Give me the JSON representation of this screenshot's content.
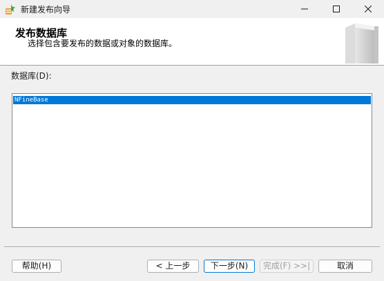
{
  "window": {
    "title": "新建发布向导",
    "controls": [
      "minimize-icon",
      "maximize-icon",
      "close-icon"
    ]
  },
  "header": {
    "title": "发布数据库",
    "subtitle": "选择包含要发布的数据或对象的数据库。"
  },
  "database_section": {
    "label": "数据库(D):",
    "items": [
      "NFineBase"
    ],
    "selected": "NFineBase"
  },
  "buttons": {
    "help": "帮助(H)",
    "back": "< 上一步",
    "next": "下一步(N)",
    "finish": "完成(F) >>|",
    "cancel": "取消"
  },
  "colors": {
    "selection": "#0078d7",
    "window_bg": "#f0f0f0",
    "header_bg": "#ffffff"
  }
}
